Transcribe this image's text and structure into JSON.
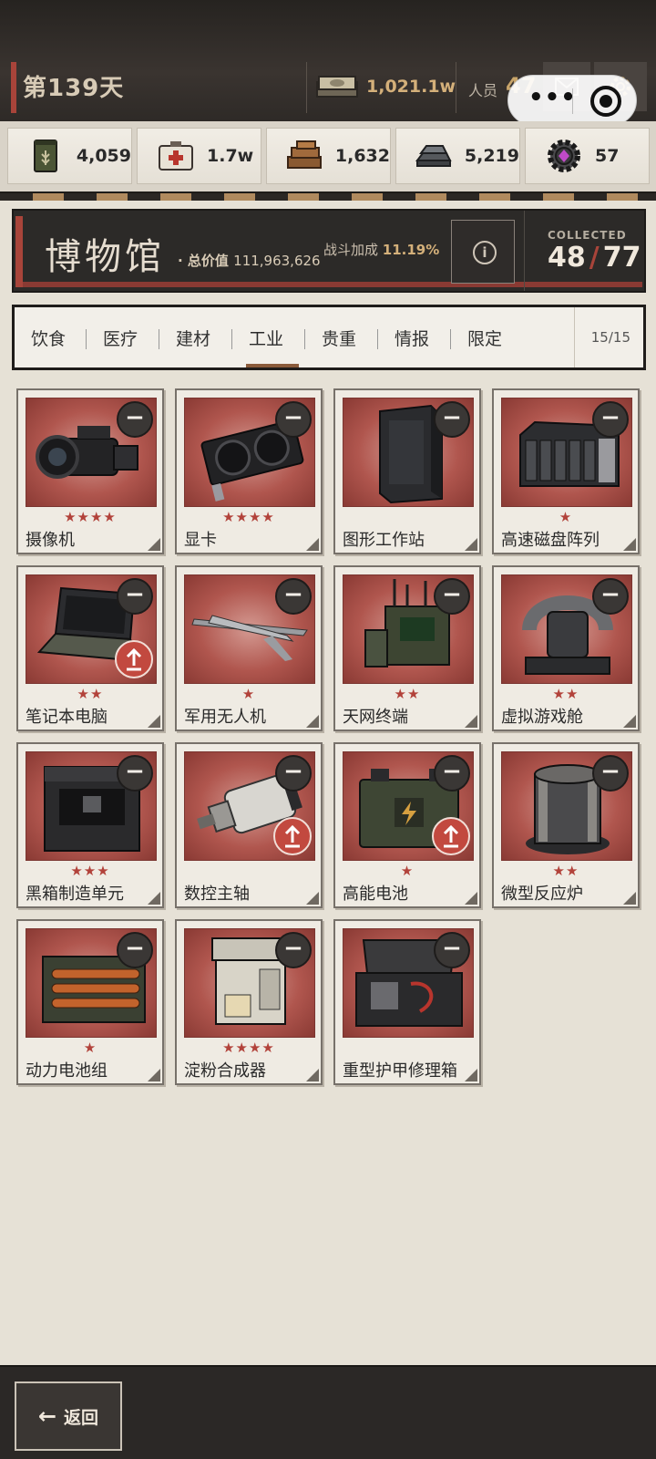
{
  "topbar": {
    "day": "第139天",
    "money": "1,021.1w",
    "staff_label": "人员",
    "staff_value": "47",
    "icons": [
      "money-stack-icon",
      "mail-icon",
      "gear-icon"
    ]
  },
  "capsule": {
    "more_label": "•••"
  },
  "resources": [
    {
      "name": "food-can-icon",
      "value": "4,059"
    },
    {
      "name": "medkit-icon",
      "value": "1.7w"
    },
    {
      "name": "wood-planks-icon",
      "value": "1,632"
    },
    {
      "name": "steel-ingot-icon",
      "value": "5,219"
    },
    {
      "name": "gear-chip-icon",
      "value": "57"
    }
  ],
  "museum": {
    "title": "博物馆",
    "total_label": "· 总价值",
    "total_value": "111,963,626",
    "bonus_label": "战斗加成",
    "bonus_value": "11.19%",
    "info_glyph": "i",
    "collected_label": "COLLECTED",
    "collected": "48",
    "total": "77"
  },
  "tabs": {
    "items": [
      "饮食",
      "医疗",
      "建材",
      "工业",
      "贵重",
      "情报",
      "限定"
    ],
    "active": "工业",
    "count": "15/15"
  },
  "items": [
    {
      "name": "摄像机",
      "stars": "★★★★",
      "upgrade": false
    },
    {
      "name": "显卡",
      "stars": "★★★★",
      "upgrade": false
    },
    {
      "name": "图形工作站",
      "stars": "",
      "upgrade": false
    },
    {
      "name": "高速磁盘阵列",
      "stars": "★",
      "upgrade": false
    },
    {
      "name": "笔记本电脑",
      "stars": "★★",
      "upgrade": true
    },
    {
      "name": "军用无人机",
      "stars": "★",
      "upgrade": false
    },
    {
      "name": "天网终端",
      "stars": "★★",
      "upgrade": false
    },
    {
      "name": "虚拟游戏舱",
      "stars": "★★",
      "upgrade": false
    },
    {
      "name": "黑箱制造单元",
      "stars": "★★★",
      "upgrade": false
    },
    {
      "name": "数控主轴",
      "stars": "",
      "upgrade": true
    },
    {
      "name": "高能电池",
      "stars": "★",
      "upgrade": true
    },
    {
      "name": "微型反应炉",
      "stars": "★★",
      "upgrade": false
    },
    {
      "name": "动力电池组",
      "stars": "★",
      "upgrade": false
    },
    {
      "name": "淀粉合成器",
      "stars": "★★★★",
      "upgrade": false
    },
    {
      "name": "重型护甲修理箱",
      "stars": "",
      "upgrade": false
    }
  ],
  "bottom": {
    "back_label": "返回"
  },
  "colors": {
    "accent_red": "#a8443a",
    "gold": "#d4b07a",
    "card_bg": "#b0564e"
  }
}
